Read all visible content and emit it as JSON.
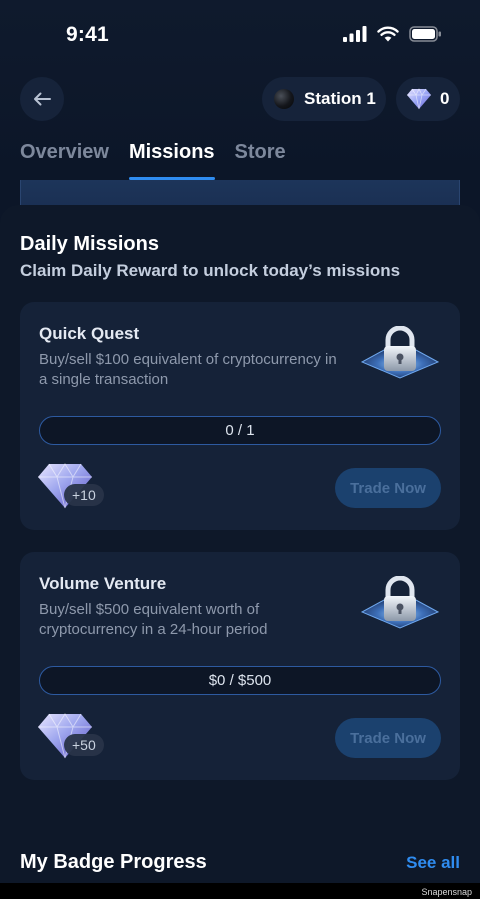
{
  "status_bar": {
    "time": "9:41"
  },
  "header": {
    "station_label": "Station 1",
    "gem_count": "0"
  },
  "tabs": [
    {
      "label": "Overview",
      "active": false
    },
    {
      "label": "Missions",
      "active": true
    },
    {
      "label": "Store",
      "active": false
    }
  ],
  "daily": {
    "title": "Daily Missions",
    "subtitle": "Claim Daily Reward to unlock today’s missions"
  },
  "missions": [
    {
      "title": "Quick Quest",
      "description": "Buy/sell $100 equivalent of cryptocurrency in a single transaction",
      "progress_text": "0 / 1",
      "progress_fraction": 0,
      "reward": "+10",
      "button_label": "Trade Now"
    },
    {
      "title": "Volume Venture",
      "description": "Buy/sell $500 equivalent worth of cryptocurrency in a 24-hour period",
      "progress_text": "$0 / $500",
      "progress_fraction": 0,
      "reward": "+50",
      "button_label": "Trade Now"
    }
  ],
  "badge_section": {
    "title": "My Badge Progress",
    "see_all": "See all"
  },
  "watermark": "Snapensnap",
  "colors": {
    "accent": "#2f8cf0",
    "background": "#0c1423",
    "card": "#152238",
    "button_disabled": "#1b416e"
  }
}
